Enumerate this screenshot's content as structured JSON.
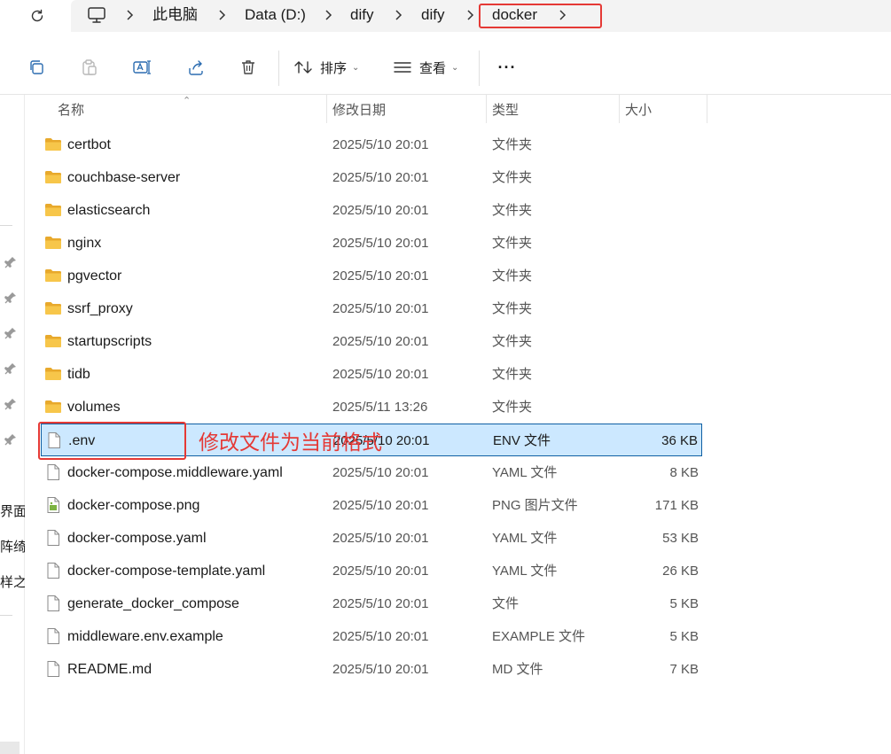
{
  "breadcrumb": {
    "items": [
      "此电脑",
      "Data (D:)",
      "dify",
      "dify",
      "docker"
    ]
  },
  "toolbar": {
    "sort_label": "排序",
    "view_label": "查看",
    "more_label": "···"
  },
  "columns": {
    "name": "名称",
    "modified": "修改日期",
    "type": "类型",
    "size": "大小"
  },
  "sidebar": {
    "partial_texts": [
      "界面",
      "阵绮",
      "样之"
    ]
  },
  "files": [
    {
      "name": "certbot",
      "date": "2025/5/10 20:01",
      "type": "文件夹",
      "size": "",
      "icon": "folder-icon"
    },
    {
      "name": "couchbase-server",
      "date": "2025/5/10 20:01",
      "type": "文件夹",
      "size": "",
      "icon": "folder-icon"
    },
    {
      "name": "elasticsearch",
      "date": "2025/5/10 20:01",
      "type": "文件夹",
      "size": "",
      "icon": "folder-icon"
    },
    {
      "name": "nginx",
      "date": "2025/5/10 20:01",
      "type": "文件夹",
      "size": "",
      "icon": "folder-icon"
    },
    {
      "name": "pgvector",
      "date": "2025/5/10 20:01",
      "type": "文件夹",
      "size": "",
      "icon": "folder-icon"
    },
    {
      "name": "ssrf_proxy",
      "date": "2025/5/10 20:01",
      "type": "文件夹",
      "size": "",
      "icon": "folder-icon"
    },
    {
      "name": "startupscripts",
      "date": "2025/5/10 20:01",
      "type": "文件夹",
      "size": "",
      "icon": "folder-icon"
    },
    {
      "name": "tidb",
      "date": "2025/5/10 20:01",
      "type": "文件夹",
      "size": "",
      "icon": "folder-icon"
    },
    {
      "name": "volumes",
      "date": "2025/5/11 13:26",
      "type": "文件夹",
      "size": "",
      "icon": "folder-icon"
    },
    {
      "name": ".env",
      "date": "2025/5/10 20:01",
      "type": "ENV 文件",
      "size": "36 KB",
      "icon": "file-icon",
      "selected": true
    },
    {
      "name": "docker-compose.middleware.yaml",
      "date": "2025/5/10 20:01",
      "type": "YAML 文件",
      "size": "8 KB",
      "icon": "file-icon"
    },
    {
      "name": "docker-compose.png",
      "date": "2025/5/10 20:01",
      "type": "PNG 图片文件",
      "size": "171 KB",
      "icon": "image-file-icon"
    },
    {
      "name": "docker-compose.yaml",
      "date": "2025/5/10 20:01",
      "type": "YAML 文件",
      "size": "53 KB",
      "icon": "file-icon"
    },
    {
      "name": "docker-compose-template.yaml",
      "date": "2025/5/10 20:01",
      "type": "YAML 文件",
      "size": "26 KB",
      "icon": "file-icon"
    },
    {
      "name": "generate_docker_compose",
      "date": "2025/5/10 20:01",
      "type": "文件",
      "size": "5 KB",
      "icon": "file-icon"
    },
    {
      "name": "middleware.env.example",
      "date": "2025/5/10 20:01",
      "type": "EXAMPLE 文件",
      "size": "5 KB",
      "icon": "file-icon"
    },
    {
      "name": "README.md",
      "date": "2025/5/10 20:01",
      "type": "MD 文件",
      "size": "7 KB",
      "icon": "file-icon"
    }
  ],
  "annotation": {
    "text": "修改文件为当前格式",
    "color": "#e53935"
  },
  "colors": {
    "selection_bg": "#cce8ff",
    "selection_border": "#0f5fa3",
    "folder": "#f7c64a",
    "highlight_red": "#e53935"
  }
}
